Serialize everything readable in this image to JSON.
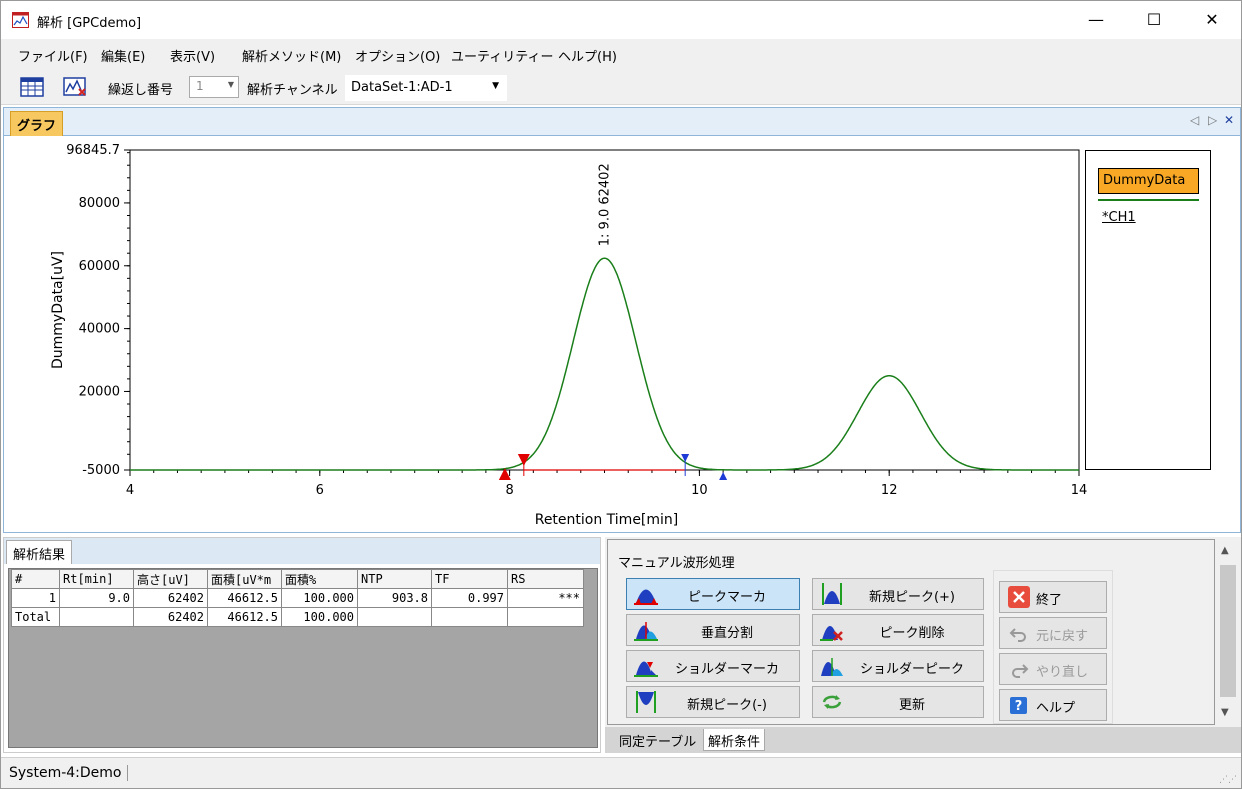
{
  "window": {
    "title": "解析 [GPCdemo]",
    "minimize": "—",
    "maximize": "☐",
    "close": "✕"
  },
  "menu": [
    "ファイル(F)",
    "編集(E)",
    "表示(V)",
    "解析メソッド(M)",
    "オプション(O)",
    "ユーティリティー",
    "ヘルプ(H)"
  ],
  "toolbar": {
    "repeat_label": "繰返し番号",
    "repeat_value": "1",
    "channel_label": "解析チャンネル",
    "channel_value": "DataSet-1:AD-1"
  },
  "graph_panel": {
    "tab": "グラフ",
    "ctrl_left": "◁",
    "ctrl_right": "▷",
    "ctrl_close": "✕"
  },
  "chart_data": {
    "type": "line",
    "xlabel": "Retention Time[min]",
    "ylabel": "DummyData[uV]",
    "xlim": [
      4,
      14
    ],
    "ylim": [
      -5000,
      96845.7
    ],
    "x_ticks": [
      4,
      6,
      8,
      10,
      12,
      14
    ],
    "y_ticks": [
      -5000,
      20000,
      40000,
      60000,
      80000,
      96845.7
    ],
    "y_tick_labels": [
      "-5000",
      "20000",
      "40000",
      "60000",
      "80000",
      "96845.7"
    ],
    "baseline": -5000,
    "peaks": [
      {
        "center": 9.0,
        "height": 62402,
        "sigma": 0.33
      },
      {
        "center": 12.0,
        "height": 25000,
        "sigma": 0.33
      }
    ],
    "peak_label": "1: 9.0 62402",
    "peak_baseline": {
      "start": 8.15,
      "end": 9.85,
      "color": "#e00000"
    },
    "markers": [
      {
        "x": 7.95,
        "kind": "up",
        "color": "#e00000"
      },
      {
        "x": 8.15,
        "kind": "down",
        "color": "#e00000"
      },
      {
        "x": 9.85,
        "kind": "down",
        "color": "#1e3bd6"
      },
      {
        "x": 10.25,
        "kind": "up",
        "color": "#1e3bd6"
      }
    ],
    "series": [
      {
        "name": "*CH1",
        "color": "#1a7f1a"
      }
    ],
    "legend_title": "DummyData",
    "grid": false,
    "legend_position": "right"
  },
  "results": {
    "tab": "解析結果",
    "columns": [
      "#",
      "Rt[min]",
      "高さ[uV]",
      "面積[uV*m",
      "面積%",
      "NTP",
      "TF",
      "RS"
    ],
    "rows": [
      [
        "1",
        "9.0",
        "62402",
        "46612.5",
        "100.000",
        "903.8",
        "0.997",
        "***"
      ],
      [
        "Total",
        "",
        "62402",
        "46612.5",
        "100.000",
        "",
        "",
        ""
      ]
    ]
  },
  "manual": {
    "title": "マニュアル波形処理",
    "buttons": {
      "peak_marker": "ピークマーカ",
      "vertical_split": "垂直分割",
      "shoulder_marker": "ショルダーマーカ",
      "new_peak_minus": "新規ピーク(-)",
      "new_peak_plus": "新規ピーク(+)",
      "peak_delete": "ピーク削除",
      "shoulder_peak": "ショルダーピーク",
      "update": "更新",
      "exit": "終了",
      "undo": "元に戻す",
      "redo": "やり直し",
      "help": "ヘルプ"
    },
    "bottom_tabs": [
      "同定テーブル",
      "解析条件"
    ]
  },
  "status": {
    "text": "System-4:Demo"
  },
  "colors": {
    "accent": "#f9a825",
    "curve": "#1a7f1a",
    "peak_marker": "#e00000",
    "tail_marker": "#1e3bd6"
  }
}
